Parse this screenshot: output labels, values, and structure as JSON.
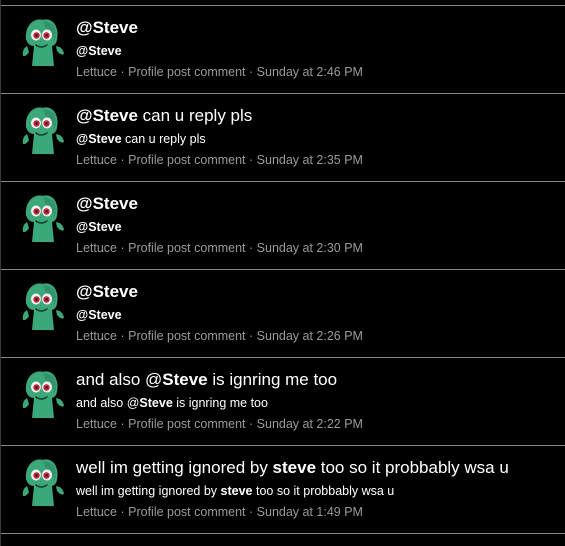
{
  "items": [
    {
      "title_parts": [
        {
          "t": "@Steve",
          "b": true
        }
      ],
      "snippet_parts": [
        {
          "t": "@Steve",
          "b": true
        }
      ],
      "author": "Lettuce",
      "sep": " · ",
      "type": "Profile post comment",
      "time": "Sunday at 2:46 PM"
    },
    {
      "title_parts": [
        {
          "t": "@Steve",
          "b": true
        },
        {
          "t": " can u reply pls",
          "b": false
        }
      ],
      "snippet_parts": [
        {
          "t": "@Steve",
          "b": true
        },
        {
          "t": " can u reply pls",
          "b": false
        }
      ],
      "author": "Lettuce",
      "sep": " · ",
      "type": "Profile post comment",
      "time": "Sunday at 2:35 PM"
    },
    {
      "title_parts": [
        {
          "t": "@Steve",
          "b": true
        }
      ],
      "snippet_parts": [
        {
          "t": "@Steve",
          "b": true
        }
      ],
      "author": "Lettuce",
      "sep": " · ",
      "type": "Profile post comment",
      "time": "Sunday at 2:30 PM"
    },
    {
      "title_parts": [
        {
          "t": "@Steve",
          "b": true
        }
      ],
      "snippet_parts": [
        {
          "t": "@Steve",
          "b": true
        }
      ],
      "author": "Lettuce",
      "sep": " · ",
      "type": "Profile post comment",
      "time": "Sunday at 2:26 PM"
    },
    {
      "title_parts": [
        {
          "t": "and also @",
          "b": false
        },
        {
          "t": "Steve",
          "b": true
        },
        {
          "t": " is ignring me too",
          "b": false
        }
      ],
      "snippet_parts": [
        {
          "t": "and also @",
          "b": false
        },
        {
          "t": "Steve",
          "b": true
        },
        {
          "t": " is ignring me too",
          "b": false
        }
      ],
      "author": "Lettuce",
      "sep": " · ",
      "type": "Profile post comment",
      "time": "Sunday at 2:22 PM"
    },
    {
      "title_parts": [
        {
          "t": "well im getting ignored by ",
          "b": false
        },
        {
          "t": "steve",
          "b": true
        },
        {
          "t": " too so it probbably wsa u",
          "b": false
        }
      ],
      "snippet_parts": [
        {
          "t": "well im getting ignored by ",
          "b": false
        },
        {
          "t": "steve",
          "b": true
        },
        {
          "t": " too so it probbably wsa u",
          "b": false
        }
      ],
      "author": "Lettuce",
      "sep": " · ",
      "type": "Profile post comment",
      "time": "Sunday at 1:49 PM"
    }
  ],
  "avatar": {
    "icon": "gumby-avatar-icon",
    "body_color": "#3aa878",
    "body_dark": "#2a7f58",
    "eye_white": "#f2eef0",
    "eye_red": "#c4243c"
  }
}
